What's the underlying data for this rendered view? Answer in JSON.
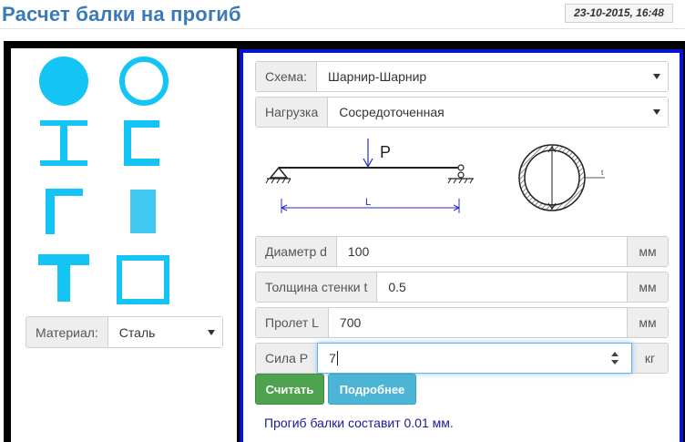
{
  "header": {
    "title": "Расчет балки на прогиб",
    "datetime": "23-10-2015, 16:48"
  },
  "shapes": [
    {
      "name": "solid-circle-section-icon"
    },
    {
      "name": "hollow-circle-section-icon"
    },
    {
      "name": "i-beam-section-icon"
    },
    {
      "name": "channel-section-icon"
    },
    {
      "name": "angle-section-icon"
    },
    {
      "name": "rectangle-section-icon"
    },
    {
      "name": "t-section-icon"
    },
    {
      "name": "hollow-square-section-icon"
    }
  ],
  "material": {
    "label": "Материал:",
    "value": "Сталь"
  },
  "scheme": {
    "label": "Схема:",
    "value": "Шарнир-Шарнир"
  },
  "load": {
    "label": "Нагрузка",
    "value": "Сосредоточенная"
  },
  "diagram": {
    "force_label": "P",
    "length_label": "L",
    "thickness_label": "t"
  },
  "inputs": {
    "diameter": {
      "label": "Диаметр d",
      "value": "100",
      "unit": "мм"
    },
    "wall": {
      "label": "Толщина стенки t",
      "value": "0.5",
      "unit": "мм"
    },
    "span": {
      "label": "Пролет L",
      "value": "700",
      "unit": "мм"
    },
    "force": {
      "label": "Сила P",
      "value": "7",
      "unit": "кг"
    }
  },
  "buttons": {
    "calculate": "Считать",
    "details": "Подробнее"
  },
  "result": {
    "text": "Прогиб балки составит 0.01 мм."
  },
  "colors": {
    "accent": "#13c4f5",
    "title": "#3a7ab8",
    "panel_border": "#0015d6",
    "calc_button": "#4fa24f",
    "details_button": "#4cb5d6",
    "result_text": "#1a1a99"
  }
}
